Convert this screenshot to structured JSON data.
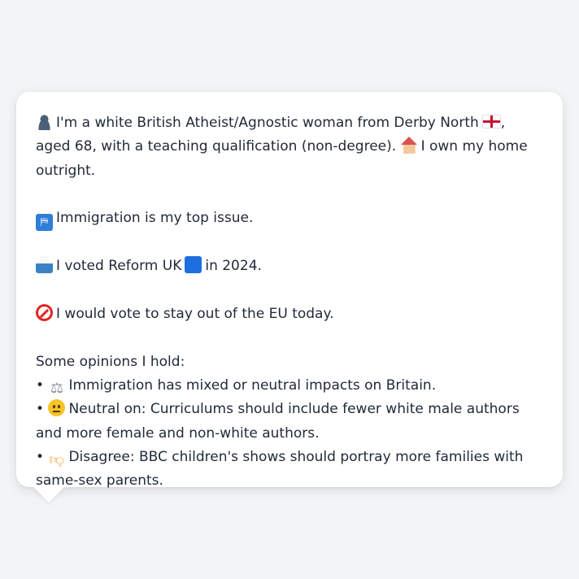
{
  "profile": {
    "intro_line": "I'm a white British Atheist/Agnostic woman from Derby North",
    "intro_line_tail": ", aged 68, with a teaching qualification (non-degree).",
    "home": "I own my home outright.",
    "top_issue": "Immigration is my top issue.",
    "vote_prefix": "I voted Reform UK",
    "vote_suffix": "in 2024.",
    "eu": "I would vote to stay out of the EU today.",
    "opinions_heading": "Some opinions I hold:",
    "opinions": [
      {
        "bullet": "•",
        "icon": "scales-icon",
        "text": "Immigration has mixed or neutral impacts on Britain."
      },
      {
        "bullet": "•",
        "icon": "neutral-face-icon",
        "text": "Neutral on: Curriculums should include fewer white male authors and more female and non-white authors."
      },
      {
        "bullet": "•",
        "icon": "thumbs-down-icon",
        "text": "Disagree: BBC children's shows should portray more families with same-sex parents."
      }
    ]
  },
  "icons": {
    "person": "bust-silhouette-icon",
    "flag": "england-flag-icon",
    "house": "house-icon",
    "passport": "passport-control-icon",
    "ballot": "ballot-box-icon",
    "party_color": "blue-square-icon",
    "no": "prohibited-icon"
  },
  "colors": {
    "background": "#f3f4f6",
    "card": "#ffffff",
    "text": "#1f2937",
    "party_blue": "#1d6fe0"
  }
}
